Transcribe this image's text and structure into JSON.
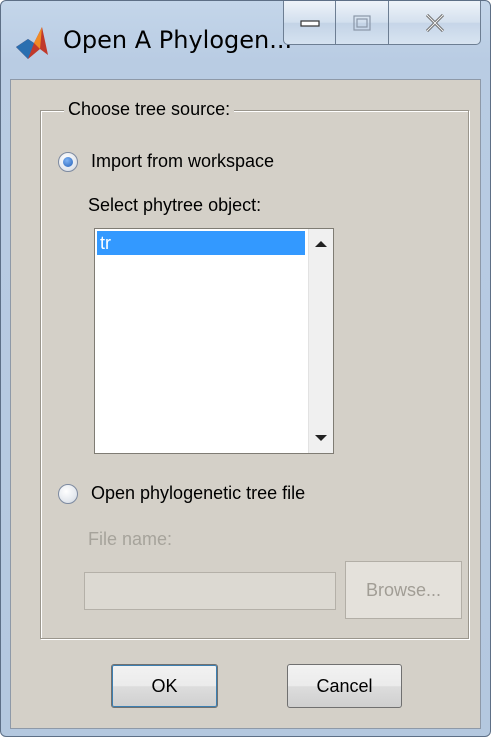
{
  "window": {
    "title": "Open A Phylogen...",
    "controls": {
      "minimize": "minimize-icon",
      "maximize": "maximize-icon",
      "close": "close-icon"
    }
  },
  "group": {
    "title": "Choose tree source:"
  },
  "workspace_option": {
    "label": "Import from workspace",
    "selected": true,
    "list_label": "Select phytree object:",
    "items": [
      "tr"
    ],
    "selected_item": "tr"
  },
  "file_option": {
    "label": "Open phylogenetic tree file",
    "selected": false,
    "file_name_label": "File name:",
    "file_name_value": "",
    "browse_label": "Browse..."
  },
  "buttons": {
    "ok": "OK",
    "cancel": "Cancel"
  },
  "colors": {
    "selection": "#3399ff",
    "dialog_background": "#d4d0c8",
    "title_bar": "#b9cce3"
  }
}
